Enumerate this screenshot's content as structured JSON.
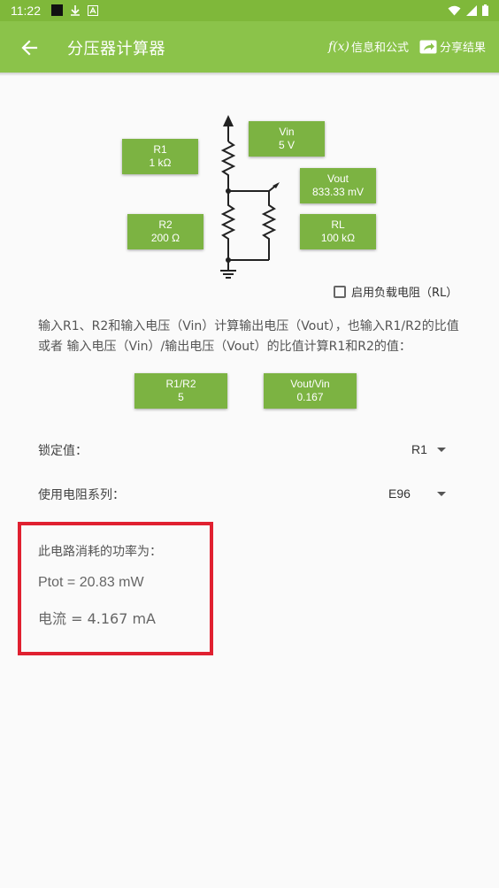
{
  "status_bar": {
    "time": "11:22"
  },
  "app_bar": {
    "title": "分压器计算器",
    "info_fx": "f(x)",
    "info_label": "信息和公式",
    "share_label": "分享结果"
  },
  "circuit": {
    "r1": {
      "label": "R1",
      "value": "1 kΩ"
    },
    "r2": {
      "label": "R2",
      "value": "200 Ω"
    },
    "vin": {
      "label": "Vin",
      "value": "5 V"
    },
    "vout": {
      "label": "Vout",
      "value": "833.33 mV"
    },
    "rl": {
      "label": "RL",
      "value": "100 kΩ"
    }
  },
  "load_checkbox": {
    "label": "启用负载电阻（RL）",
    "checked": false
  },
  "description": "输入R1、R2和输入电压（Vin）计算输出电压（Vout），也输入R1/R2的比值 或者 输入电压（Vin）/输出电压（Vout）的比值计算R1和R2的值：",
  "ratios": {
    "r1r2": {
      "label": "R1/R2",
      "value": "5"
    },
    "voutvin": {
      "label": "Vout/Vin",
      "value": "0.167"
    }
  },
  "lock": {
    "label": "锁定值：",
    "value": "R1"
  },
  "series": {
    "label": "使用电阻系列：",
    "value": "E96"
  },
  "power": {
    "title": "此电路消耗的功率为：",
    "ptot": "Ptot = 20.83 mW",
    "current": "电流 = 4.167 mA"
  },
  "colors": {
    "app_bar": "#8bc34a",
    "status_bar": "#7fb83a",
    "button": "#7cb342",
    "highlight": "#e02030"
  }
}
